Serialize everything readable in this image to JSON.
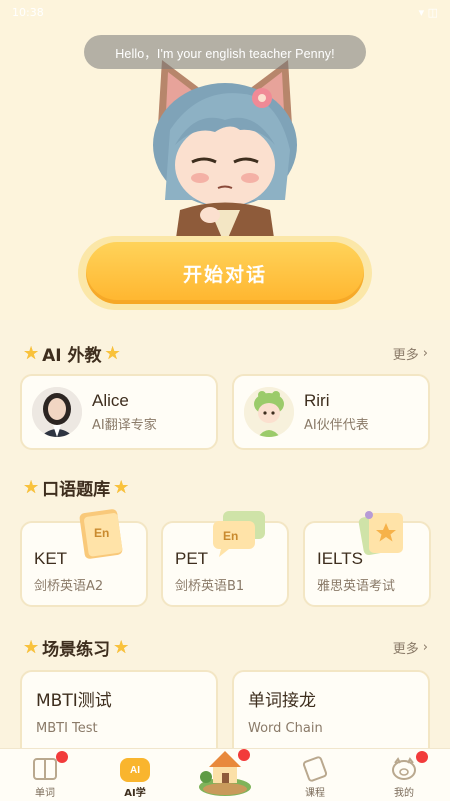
{
  "status_bar": {
    "time": "10:38",
    "right": "▾ ◫"
  },
  "hero": {
    "bubble_text": "Hello，I'm your english teacher Penny!",
    "start_button": "开始对话"
  },
  "ai_teachers": {
    "title": "AI 外教",
    "more": "更多",
    "items": [
      {
        "name": "Alice",
        "role": "AI翻译专家"
      },
      {
        "name": "Riri",
        "role": "AI伙伴代表"
      }
    ]
  },
  "oral_bank": {
    "title": "口语题库",
    "items": [
      {
        "title": "KET",
        "sub": "剑桥英语A2",
        "icon_text": "En"
      },
      {
        "title": "PET",
        "sub": "剑桥英语B1",
        "icon_text": "En"
      },
      {
        "title": "IELTS",
        "sub": "雅思英语考试",
        "icon_text": ""
      }
    ]
  },
  "scenes": {
    "title": "场景练习",
    "more": "更多",
    "items": [
      {
        "title": "MBTI测试",
        "sub": "MBTI Test"
      },
      {
        "title": "单词接龙",
        "sub": "Word Chain"
      }
    ]
  },
  "tabbar": {
    "items": [
      {
        "label": "单词",
        "icon": "book-icon"
      },
      {
        "label": "AI学",
        "icon": "ai-bear-icon",
        "badge": "AI"
      },
      {
        "label": "",
        "icon": "island-house-icon"
      },
      {
        "label": "课程",
        "icon": "course-icon"
      },
      {
        "label": "我的",
        "icon": "pig-icon"
      }
    ]
  },
  "colors": {
    "accent": "#FFB52E",
    "background": "#FBF3DE",
    "badge": "#F23B3B"
  }
}
